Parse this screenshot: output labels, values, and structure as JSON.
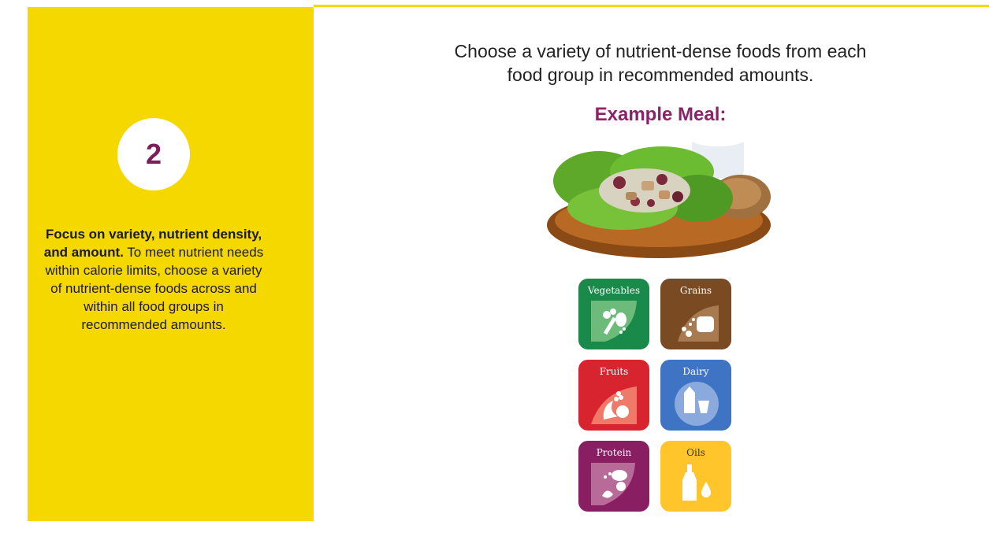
{
  "step": {
    "number": "2"
  },
  "sidebar": {
    "heading": "Focus on variety, nutrient density, and amount.",
    "body": "To meet nutrient needs within calorie limits, choose a variety of nutrient-dense foods across and within all food groups in recommended amounts."
  },
  "main": {
    "intro_line1": "Choose a variety of nutrient-dense foods from each",
    "intro_line2": "food group in recommended amounts.",
    "meal_title": "Example Meal:"
  },
  "food_groups": [
    {
      "label": "Vegetables",
      "color": "#1a8a4a",
      "icon": "vegetables-icon"
    },
    {
      "label": "Grains",
      "color": "#7a4a22",
      "icon": "grains-icon"
    },
    {
      "label": "Fruits",
      "color": "#d8242e",
      "icon": "fruits-icon"
    },
    {
      "label": "Dairy",
      "color": "#3f73c4",
      "icon": "dairy-icon"
    },
    {
      "label": "Protein",
      "color": "#8a1e62",
      "icon": "protein-icon"
    },
    {
      "label": "Oils",
      "color": "#ffc52a",
      "icon": "oils-icon"
    }
  ],
  "colors": {
    "panel": "#f5d800",
    "accent": "#8a2468"
  }
}
